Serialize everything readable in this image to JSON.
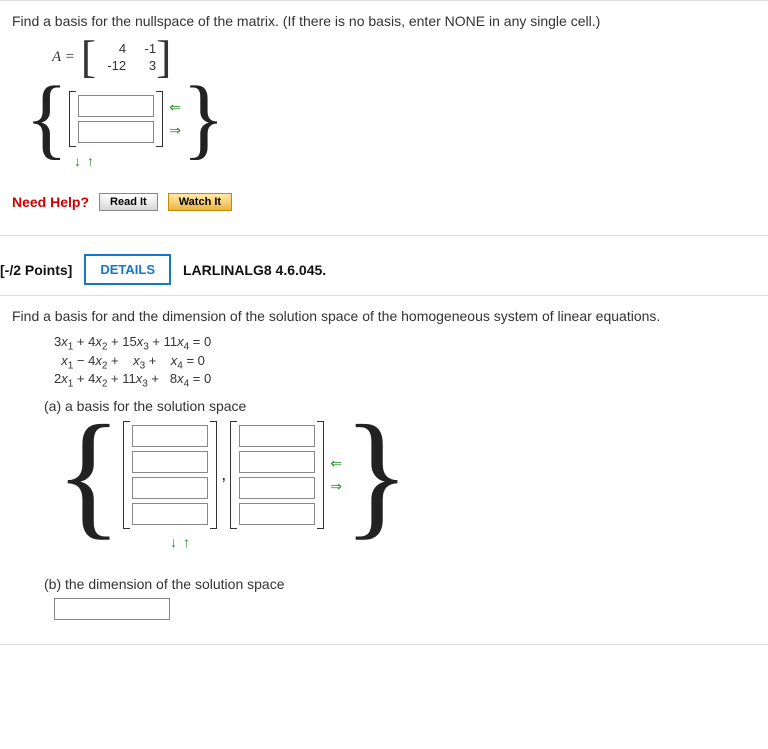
{
  "q1": {
    "prompt": "Find a basis for the nullspace of the matrix. (If there is no basis, enter NONE in any single cell.)",
    "A_label": "A =",
    "matrix": [
      [
        "4",
        "-1"
      ],
      [
        "-12",
        "3"
      ]
    ],
    "needHelp": "Need Help?",
    "readIt": "Read It",
    "watchIt": "Watch It"
  },
  "header": {
    "points": "[-/2 Points]",
    "details": "DETAILS",
    "ref": "LARLINALG8 4.6.045."
  },
  "q2": {
    "prompt": "Find a basis for and the dimension of the solution space of the homogeneous system of linear equations.",
    "eq1_l": "3x₁ + 4x₂ + 15x₃ + 11x₄",
    "eq2_l": "x₁ − 4x₂ +    x₃ +    x₄",
    "eq3_l": "2x₁ + 4x₂ + 11x₃ +  8x₄",
    "eq_r": "= 0",
    "part_a": "(a) a basis for the solution space",
    "part_b": "(b) the dimension of the solution space"
  },
  "arrows": {
    "left": "⇐",
    "right": "⇒",
    "down": "↓",
    "up": "↑"
  }
}
